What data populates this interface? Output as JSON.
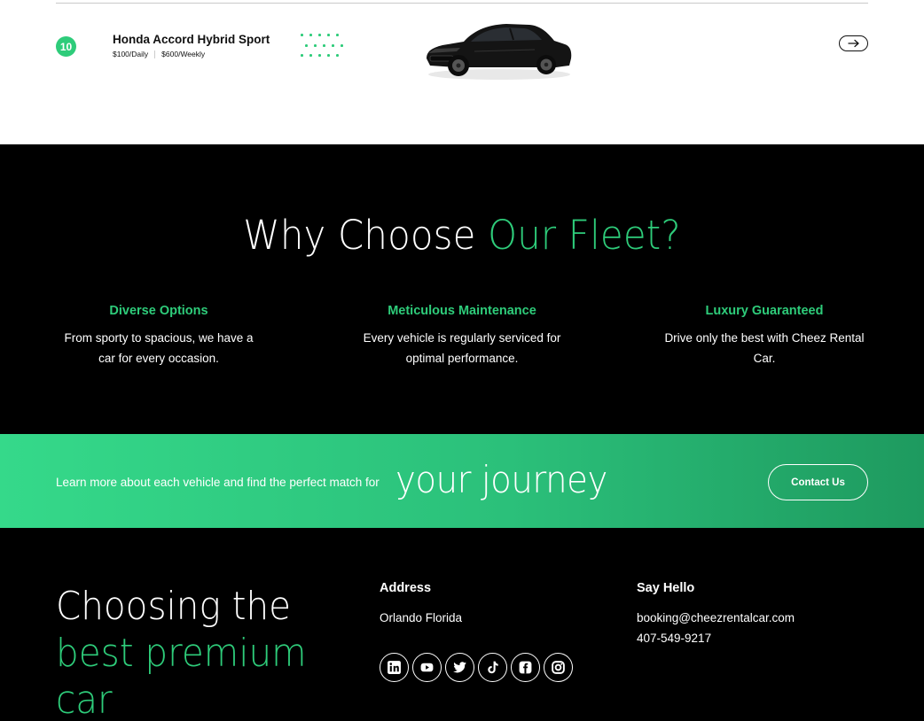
{
  "listing": {
    "number": "10",
    "car_name": "Honda Accord Hybrid Sport",
    "daily_price": "$100/Daily",
    "weekly_price": "$600/Weekly",
    "accent_color": "#2ecc7a"
  },
  "why": {
    "title_plain": "Why Choose ",
    "title_accent": "Our Fleet?",
    "features": [
      {
        "title": "Diverse Options",
        "line1": "From sporty to spacious, we have a",
        "line2": "car for every occasion."
      },
      {
        "title": "Meticulous Maintenance",
        "line1": "Every vehicle is regularly serviced for",
        "line2": "optimal performance."
      },
      {
        "title": "Luxury Guaranteed",
        "line1": "Drive only the best with Cheez Rental",
        "line2": "Car."
      }
    ]
  },
  "cta": {
    "lead": "Learn more about each vehicle and find the perfect match for",
    "big": "your journey",
    "button": "Contact Us"
  },
  "footer": {
    "tagline_line1": "Choosing the",
    "tagline_line2": "best premium",
    "tagline_line3": "car",
    "address_title": "Address",
    "address": "Orlando Florida",
    "hello_title": "Say Hello",
    "email": "booking@cheezrentalcar.com",
    "phone": "407-549-9217",
    "socials": [
      "linkedin-icon",
      "youtube-icon",
      "twitter-icon",
      "tiktok-icon",
      "facebook-icon",
      "instagram-icon"
    ]
  }
}
